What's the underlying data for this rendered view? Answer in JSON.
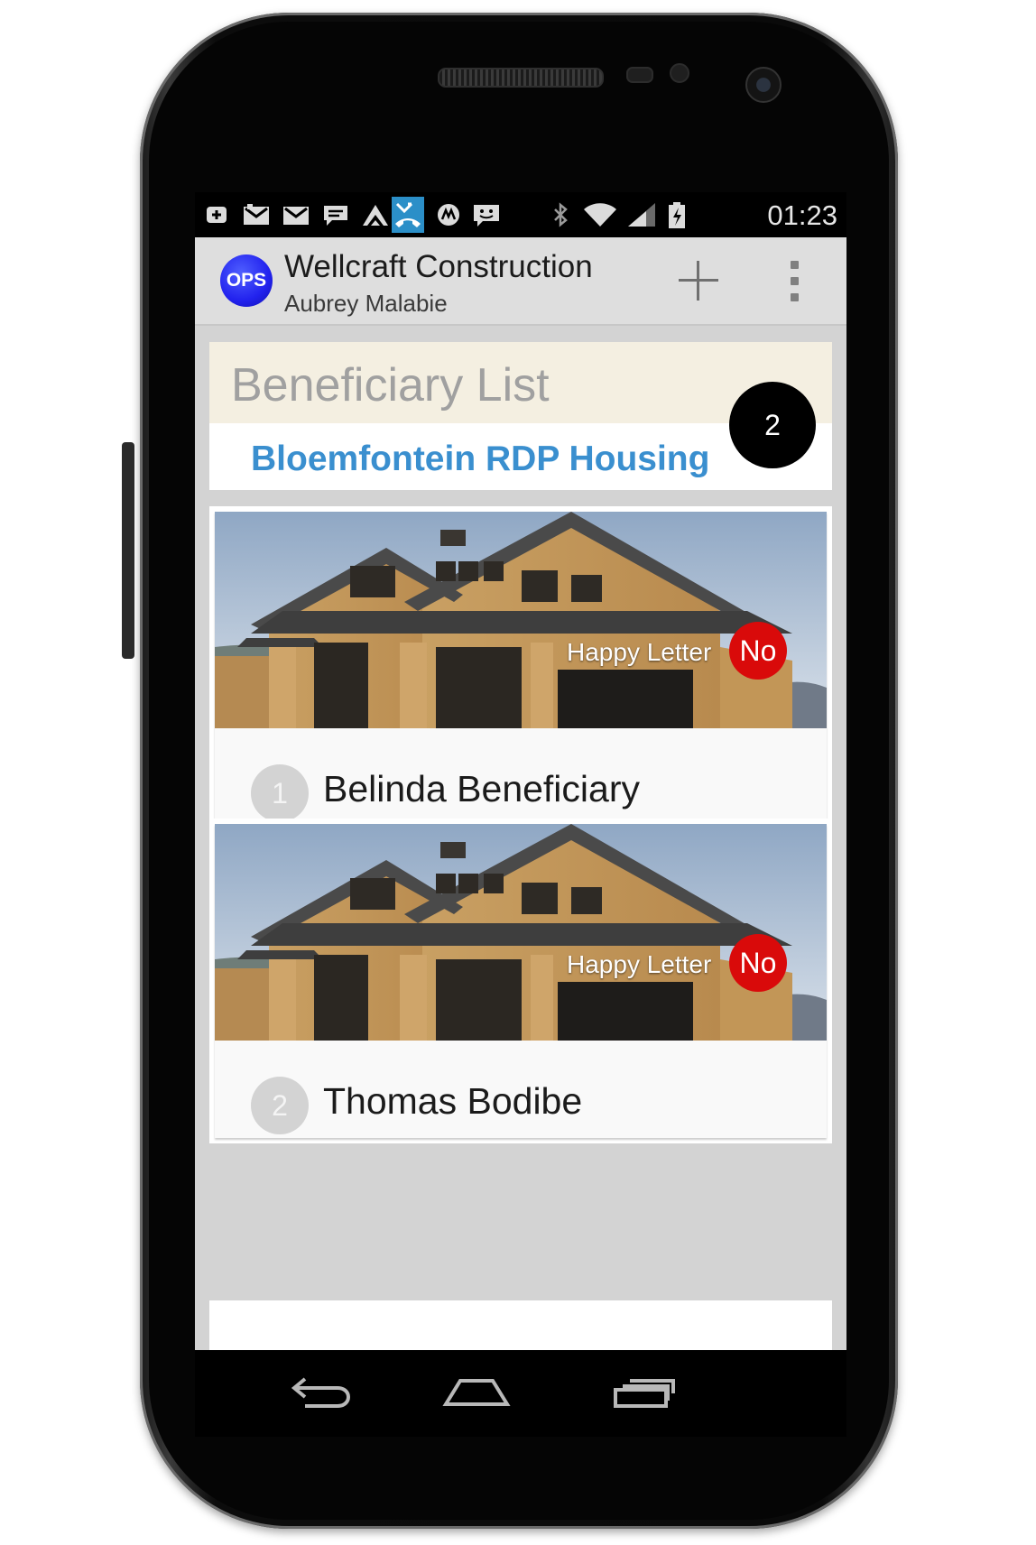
{
  "status_bar": {
    "time": "01:23",
    "notification_icons": [
      "plus-badge-icon",
      "gmail-icon",
      "gmail-icon",
      "chat-bubble-icon",
      "hills-icon",
      "missed-call-icon",
      "motorola-icon",
      "messaging-icon"
    ],
    "system_icons": [
      "bluetooth-icon",
      "wifi-icon",
      "signal-icon",
      "battery-charging-icon"
    ]
  },
  "action_bar": {
    "logo_text": "OPS",
    "title": "Wellcraft Construction",
    "subtitle": "Aubrey Malabie",
    "add_icon": "plus-icon",
    "overflow_icon": "overflow-menu-icon"
  },
  "header": {
    "title": "Beneficiary List",
    "count": "2",
    "project_name": "Bloemfontein RDP Housing"
  },
  "beneficiaries": [
    {
      "number": "1",
      "name": "Belinda Beneficiary",
      "happy_letter_label": "Happy Letter",
      "happy_letter_status": "No"
    },
    {
      "number": "2",
      "name": "Thomas Bodibe",
      "happy_letter_label": "Happy Letter",
      "happy_letter_status": "No"
    }
  ],
  "nav_bar": {
    "back_icon": "back-icon",
    "home_icon": "home-icon",
    "recents_icon": "recent-apps-icon"
  },
  "colors": {
    "accent_blue": "#3a8fcf",
    "status_red": "#d90a0a",
    "header_band": "#f4efe1",
    "logo_blue": "#2222ee"
  }
}
